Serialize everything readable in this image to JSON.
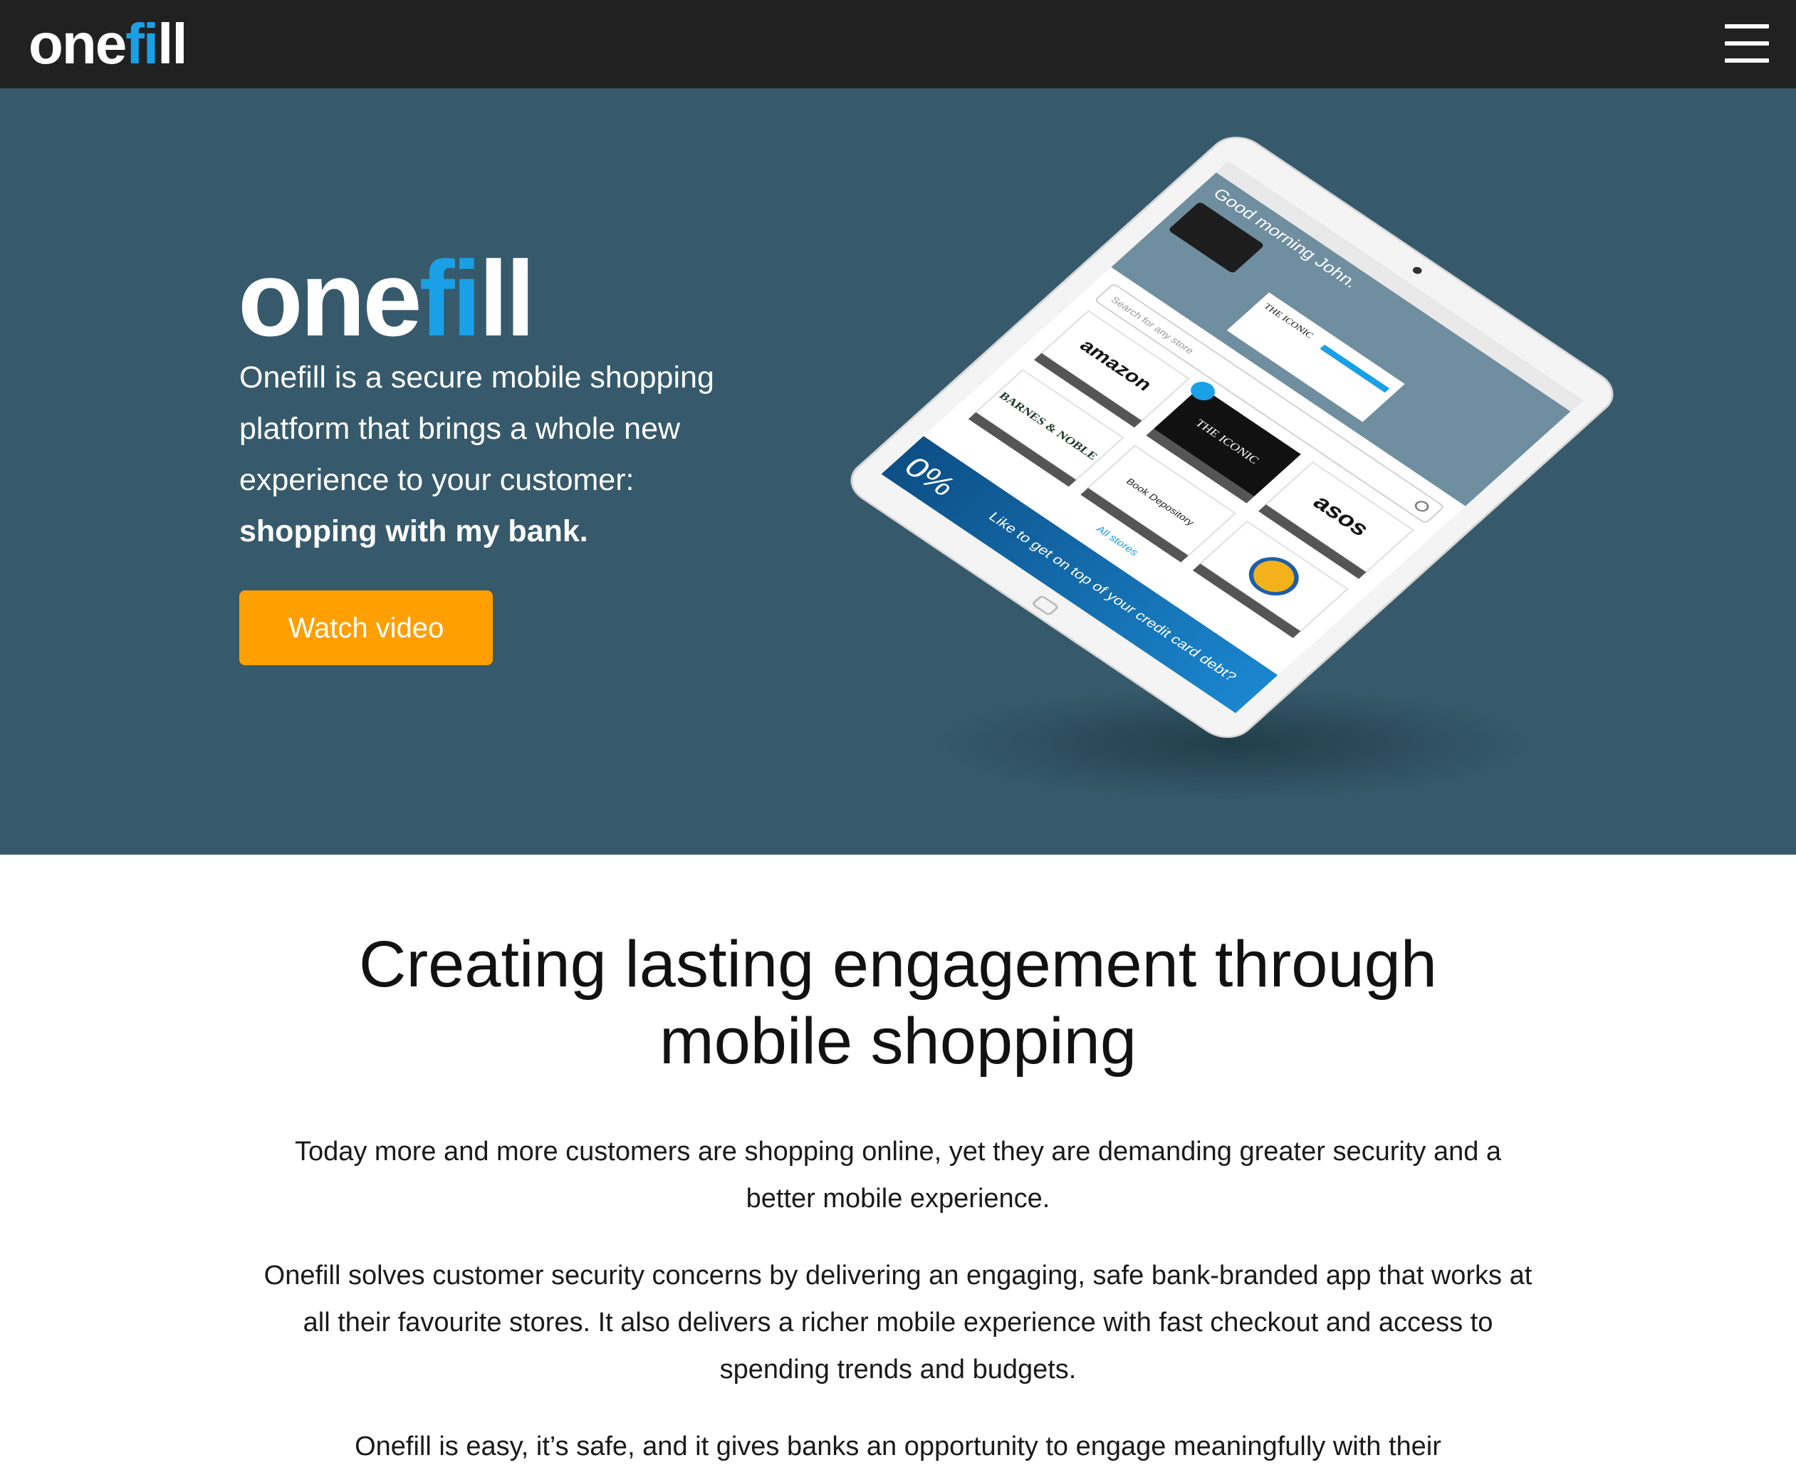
{
  "nav": {
    "logo_main": "one",
    "logo_accent": "fi",
    "logo_tail": "ll"
  },
  "hero": {
    "logo_main": "one",
    "logo_accent": "fi",
    "logo_tail": "ll",
    "intro": "Onefill is a secure mobile shopping platform that brings a whole new experience to your customer:",
    "tagline": "shopping with my bank.",
    "cta_label": "Watch video"
  },
  "tablet": {
    "greeting": "Good morning John.",
    "search_placeholder": "Search for any store",
    "promo_store": "THE ICONIC",
    "stores": [
      "amazon",
      "THE ICONIC",
      "asos",
      "BARNES & NOBLE",
      "Book Depository",
      "BUILD-A-BEAR"
    ],
    "all_stores": "All stores",
    "banner_text": "Like to get on top of your credit card debt?",
    "banner_badge": "0%"
  },
  "content": {
    "headline_line1": "Creating lasting engagement through",
    "headline_line2": "mobile shopping",
    "para1": "Today more and more customers are shopping online, yet they are demanding greater security and a better mobile experience.",
    "para2": "Onefill solves customer security concerns by delivering an engaging, safe bank-branded app that works at all their favourite stores. It also delivers a richer mobile experience with fast checkout and access to spending trends and budgets.",
    "para3": "Onefill is easy, it’s safe, and it gives banks an opportunity to engage meaningfully with their"
  },
  "colors": {
    "navbar": "#212121",
    "hero_bg": "#365a6b",
    "accent_blue": "#1aa0e6",
    "cta_orange": "#ff9f00"
  }
}
